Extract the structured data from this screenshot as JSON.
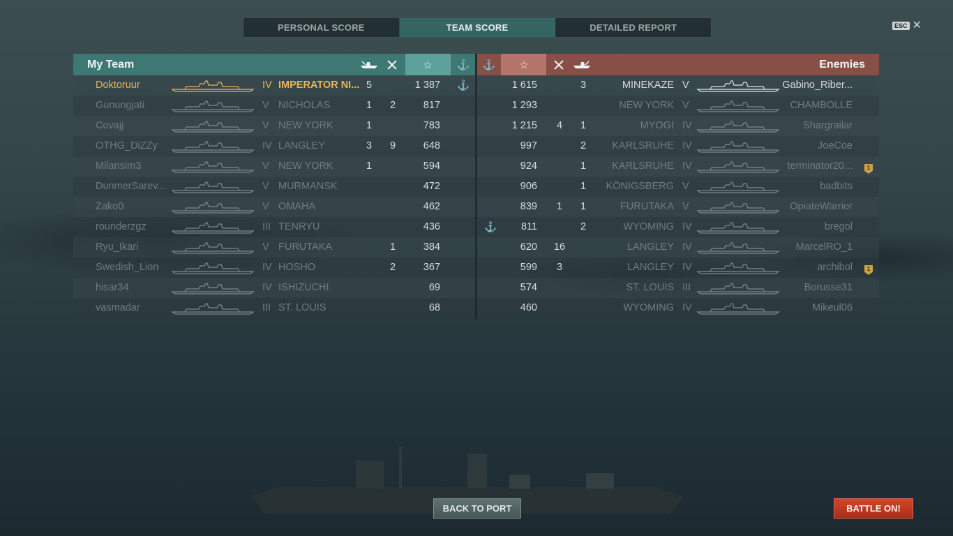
{
  "tabs": [
    {
      "label": "PERSONAL SCORE",
      "active": false
    },
    {
      "label": "TEAM SCORE",
      "active": true
    },
    {
      "label": "DETAILED REPORT",
      "active": false
    }
  ],
  "esc_label": "ESC",
  "my_team": {
    "title": "My Team",
    "players": [
      {
        "name": "Doktoruur",
        "tier": "IV",
        "ship": "IMPERATOR NI...",
        "kills": "5",
        "planes": "",
        "score": "1 387",
        "anchor": true,
        "style": "me"
      },
      {
        "name": "Gunungjati",
        "tier": "V",
        "ship": "NICHOLAS",
        "kills": "1",
        "planes": "2",
        "score": "817",
        "anchor": false,
        "style": "dim"
      },
      {
        "name": "Covajj",
        "tier": "V",
        "ship": "NEW YORK",
        "kills": "1",
        "planes": "",
        "score": "783",
        "anchor": false,
        "style": "dim"
      },
      {
        "name": "OTHG_DiZZy",
        "tier": "IV",
        "ship": "LANGLEY",
        "kills": "3",
        "planes": "9",
        "score": "648",
        "anchor": false,
        "style": "dim"
      },
      {
        "name": "Milansim3",
        "tier": "V",
        "ship": "NEW YORK",
        "kills": "1",
        "planes": "",
        "score": "594",
        "anchor": false,
        "style": "dim"
      },
      {
        "name": "DunmerSarev...",
        "tier": "V",
        "ship": "MURMANSK",
        "kills": "",
        "planes": "",
        "score": "472",
        "anchor": false,
        "style": "dim"
      },
      {
        "name": "Zako0",
        "tier": "V",
        "ship": "OMAHA",
        "kills": "",
        "planes": "",
        "score": "462",
        "anchor": false,
        "style": "dim"
      },
      {
        "name": "rounderzgz",
        "tier": "III",
        "ship": "TENRYU",
        "kills": "",
        "planes": "",
        "score": "436",
        "anchor": false,
        "style": "dim"
      },
      {
        "name": "Ryu_Ikari",
        "tier": "V",
        "ship": "FURUTAKA",
        "kills": "",
        "planes": "1",
        "score": "384",
        "anchor": false,
        "style": "dim"
      },
      {
        "name": "Swedish_Lion",
        "tier": "IV",
        "ship": "HOSHO",
        "kills": "",
        "planes": "2",
        "score": "367",
        "anchor": false,
        "style": "dim"
      },
      {
        "name": "hisar34",
        "tier": "IV",
        "ship": "ISHIZUCHI",
        "kills": "",
        "planes": "",
        "score": "69",
        "anchor": false,
        "style": "dim"
      },
      {
        "name": "vasmadar",
        "tier": "III",
        "ship": "ST. LOUIS",
        "kills": "",
        "planes": "",
        "score": "68",
        "anchor": false,
        "style": "dim"
      }
    ]
  },
  "enemies": {
    "title": "Enemies",
    "players": [
      {
        "name": "Gabino_Riber...",
        "tier": "V",
        "ship": "MINEKAZE",
        "kills": "3",
        "planes": "",
        "score": "1 615",
        "anchor": false,
        "medal": false,
        "alive": true
      },
      {
        "name": "CHAMBOLLE",
        "tier": "V",
        "ship": "NEW YORK",
        "kills": "",
        "planes": "",
        "score": "1 293",
        "anchor": false,
        "medal": false,
        "alive": false
      },
      {
        "name": "Shargrailar",
        "tier": "IV",
        "ship": "MYOGI",
        "kills": "1",
        "planes": "4",
        "score": "1 215",
        "anchor": false,
        "medal": false,
        "alive": false
      },
      {
        "name": "JoeCoe",
        "tier": "IV",
        "ship": "KARLSRUHE",
        "kills": "2",
        "planes": "",
        "score": "997",
        "anchor": false,
        "medal": false,
        "alive": false
      },
      {
        "name": "terminator20...",
        "tier": "IV",
        "ship": "KARLSRUHE",
        "kills": "1",
        "planes": "",
        "score": "924",
        "anchor": false,
        "medal": true,
        "alive": false
      },
      {
        "name": "badbits",
        "tier": "V",
        "ship": "KÖNIGSBERG",
        "kills": "1",
        "planes": "",
        "score": "906",
        "anchor": false,
        "medal": false,
        "alive": false
      },
      {
        "name": "OpiateWarrior",
        "tier": "V",
        "ship": "FURUTAKA",
        "kills": "1",
        "planes": "1",
        "score": "839",
        "anchor": false,
        "medal": false,
        "alive": false
      },
      {
        "name": "bregol",
        "tier": "IV",
        "ship": "WYOMING",
        "kills": "2",
        "planes": "",
        "score": "811",
        "anchor": true,
        "medal": false,
        "alive": false
      },
      {
        "name": "MarcelRO_1",
        "tier": "IV",
        "ship": "LANGLEY",
        "kills": "",
        "planes": "16",
        "score": "620",
        "anchor": false,
        "medal": false,
        "alive": false
      },
      {
        "name": "archibol",
        "tier": "IV",
        "ship": "LANGLEY",
        "kills": "",
        "planes": "3",
        "score": "599",
        "anchor": false,
        "medal": true,
        "alive": false
      },
      {
        "name": "Borusse31",
        "tier": "III",
        "ship": "ST. LOUIS",
        "kills": "",
        "planes": "",
        "score": "574",
        "anchor": false,
        "medal": false,
        "alive": false
      },
      {
        "name": "Mikeul06",
        "tier": "IV",
        "ship": "WYOMING",
        "kills": "",
        "planes": "",
        "score": "460",
        "anchor": false,
        "medal": false,
        "alive": false
      }
    ]
  },
  "medal_text": "1",
  "buttons": {
    "back": "BACK TO PORT",
    "battle": "BATTLE ON!"
  },
  "colors": {
    "my_team_header": "#3f7e7a",
    "enemy_header": "#965046",
    "player_highlight": "#e8b659",
    "battle_button": "#c23d23"
  }
}
